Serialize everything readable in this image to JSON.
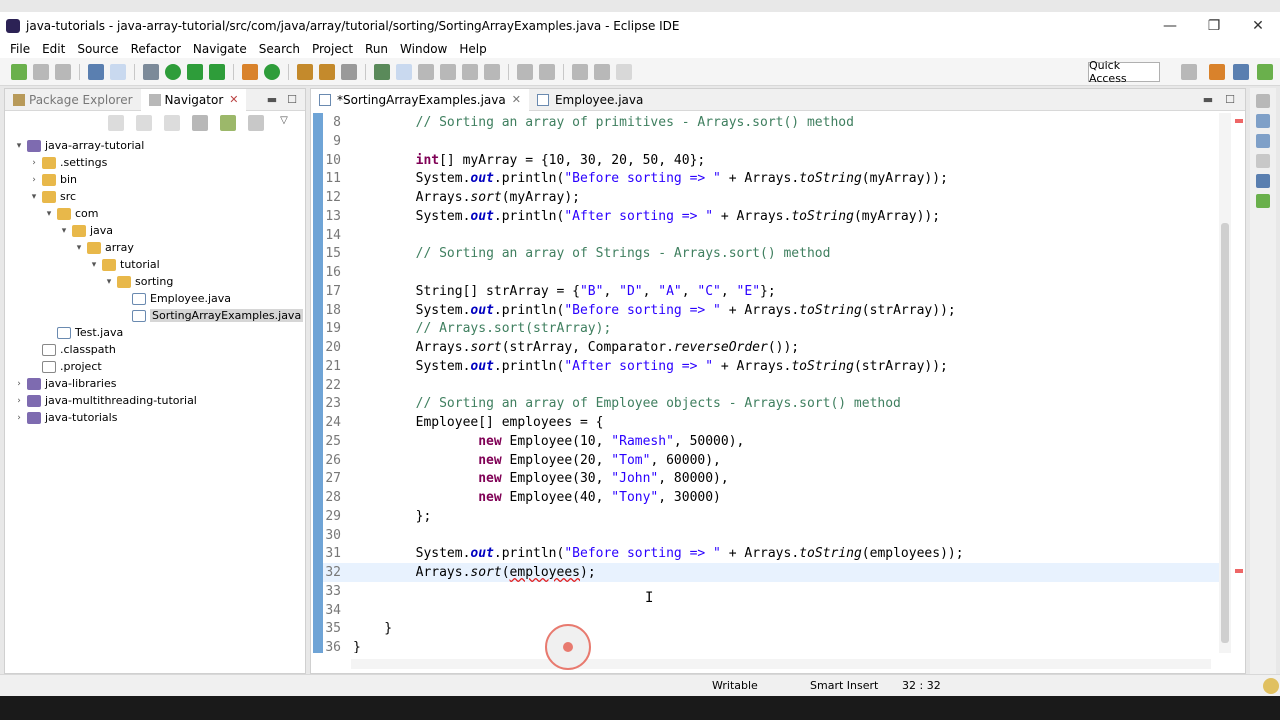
{
  "window": {
    "title": "java-tutorials - java-array-tutorial/src/com/java/array/tutorial/sorting/SortingArrayExamples.java - Eclipse IDE",
    "minimize": "—",
    "maximize": "❐",
    "close": "✕"
  },
  "menu": [
    "File",
    "Edit",
    "Source",
    "Refactor",
    "Navigate",
    "Search",
    "Project",
    "Run",
    "Window",
    "Help"
  ],
  "toolbar": {
    "quick_access": "Quick Access"
  },
  "left_panel": {
    "tabs": [
      {
        "label": "Package Explorer",
        "active": false
      },
      {
        "label": "Navigator",
        "active": true
      }
    ],
    "close_glyph": "✕",
    "tree": [
      {
        "label": "java-array-tutorial",
        "depth": 0,
        "arrow": "▾",
        "icon": "project"
      },
      {
        "label": ".settings",
        "depth": 1,
        "arrow": "›",
        "icon": "folder"
      },
      {
        "label": "bin",
        "depth": 1,
        "arrow": "›",
        "icon": "folder"
      },
      {
        "label": "src",
        "depth": 1,
        "arrow": "▾",
        "icon": "folder"
      },
      {
        "label": "com",
        "depth": 2,
        "arrow": "▾",
        "icon": "folder"
      },
      {
        "label": "java",
        "depth": 3,
        "arrow": "▾",
        "icon": "folder"
      },
      {
        "label": "array",
        "depth": 4,
        "arrow": "▾",
        "icon": "folder"
      },
      {
        "label": "tutorial",
        "depth": 5,
        "arrow": "▾",
        "icon": "folder"
      },
      {
        "label": "sorting",
        "depth": 6,
        "arrow": "▾",
        "icon": "folder"
      },
      {
        "label": "Employee.java",
        "depth": 7,
        "arrow": "",
        "icon": "javafile"
      },
      {
        "label": "SortingArrayExamples.java",
        "depth": 7,
        "arrow": "",
        "icon": "javafile",
        "selected": true
      },
      {
        "label": "Test.java",
        "depth": 2,
        "arrow": "",
        "icon": "javafile"
      },
      {
        "label": ".classpath",
        "depth": 1,
        "arrow": "",
        "icon": "xmlfile"
      },
      {
        "label": ".project",
        "depth": 1,
        "arrow": "",
        "icon": "xmlfile"
      },
      {
        "label": "java-libraries",
        "depth": 0,
        "arrow": "›",
        "icon": "project"
      },
      {
        "label": "java-multithreading-tutorial",
        "depth": 0,
        "arrow": "›",
        "icon": "project"
      },
      {
        "label": "java-tutorials",
        "depth": 0,
        "arrow": "›",
        "icon": "project"
      }
    ]
  },
  "editor": {
    "tabs": [
      {
        "label": "*SortingArrayExamples.java",
        "active": true
      },
      {
        "label": "Employee.java",
        "active": false
      }
    ],
    "close_glyph": "✕",
    "current_line": 32,
    "lines": [
      {
        "n": "8",
        "code": [
          [
            "        ",
            ""
          ],
          [
            "// Sorting an array of primitives - Arrays.sort() method",
            "cm"
          ]
        ]
      },
      {
        "n": "9",
        "code": []
      },
      {
        "n": "10",
        "code": [
          [
            "        ",
            ""
          ],
          [
            "int",
            "kw"
          ],
          [
            "[] myArray = {10, 30, 20, 50, 40};",
            ""
          ]
        ]
      },
      {
        "n": "11",
        "code": [
          [
            "        System.",
            ""
          ],
          [
            "out",
            "fld"
          ],
          [
            ".println(",
            ""
          ],
          [
            "\"Before sorting => \"",
            "st"
          ],
          [
            " + Arrays.",
            ""
          ],
          [
            "toString",
            "it"
          ],
          [
            "(myArray));",
            ""
          ]
        ]
      },
      {
        "n": "12",
        "code": [
          [
            "        Arrays.",
            ""
          ],
          [
            "sort",
            "it"
          ],
          [
            "(myArray);",
            ""
          ]
        ]
      },
      {
        "n": "13",
        "code": [
          [
            "        System.",
            ""
          ],
          [
            "out",
            "fld"
          ],
          [
            ".println(",
            ""
          ],
          [
            "\"After sorting => \"",
            "st"
          ],
          [
            " + Arrays.",
            ""
          ],
          [
            "toString",
            "it"
          ],
          [
            "(myArray));",
            ""
          ]
        ]
      },
      {
        "n": "14",
        "code": []
      },
      {
        "n": "15",
        "code": [
          [
            "        ",
            ""
          ],
          [
            "// Sorting an array of Strings - Arrays.sort() method",
            "cm"
          ]
        ]
      },
      {
        "n": "16",
        "code": []
      },
      {
        "n": "17",
        "code": [
          [
            "        String[] strArray = {",
            ""
          ],
          [
            "\"B\"",
            "st"
          ],
          [
            ", ",
            ""
          ],
          [
            "\"D\"",
            "st"
          ],
          [
            ", ",
            ""
          ],
          [
            "\"A\"",
            "st"
          ],
          [
            ", ",
            ""
          ],
          [
            "\"C\"",
            "st"
          ],
          [
            ", ",
            ""
          ],
          [
            "\"E\"",
            "st"
          ],
          [
            "};",
            ""
          ]
        ]
      },
      {
        "n": "18",
        "code": [
          [
            "        System.",
            ""
          ],
          [
            "out",
            "fld"
          ],
          [
            ".println(",
            ""
          ],
          [
            "\"Before sorting => \"",
            "st"
          ],
          [
            " + Arrays.",
            ""
          ],
          [
            "toString",
            "it"
          ],
          [
            "(strArray));",
            ""
          ]
        ]
      },
      {
        "n": "19",
        "code": [
          [
            "        ",
            ""
          ],
          [
            "// Arrays.sort(strArray);",
            "cm"
          ]
        ]
      },
      {
        "n": "20",
        "code": [
          [
            "        Arrays.",
            ""
          ],
          [
            "sort",
            "it"
          ],
          [
            "(strArray, Comparator.",
            ""
          ],
          [
            "reverseOrder",
            "it"
          ],
          [
            "());",
            ""
          ]
        ]
      },
      {
        "n": "21",
        "code": [
          [
            "        System.",
            ""
          ],
          [
            "out",
            "fld"
          ],
          [
            ".println(",
            ""
          ],
          [
            "\"After sorting => \"",
            "st"
          ],
          [
            " + Arrays.",
            ""
          ],
          [
            "toString",
            "it"
          ],
          [
            "(strArray));",
            ""
          ]
        ]
      },
      {
        "n": "22",
        "code": []
      },
      {
        "n": "23",
        "code": [
          [
            "        ",
            ""
          ],
          [
            "// Sorting an array of Employee objects - Arrays.sort() method",
            "cm"
          ]
        ]
      },
      {
        "n": "24",
        "code": [
          [
            "        Employee[] employees = {",
            ""
          ]
        ]
      },
      {
        "n": "25",
        "code": [
          [
            "                ",
            ""
          ],
          [
            "new",
            "kw"
          ],
          [
            " Employee(10, ",
            ""
          ],
          [
            "\"Ramesh\"",
            "st"
          ],
          [
            ", 50000),",
            ""
          ]
        ]
      },
      {
        "n": "26",
        "code": [
          [
            "                ",
            ""
          ],
          [
            "new",
            "kw"
          ],
          [
            " Employee(20, ",
            ""
          ],
          [
            "\"Tom\"",
            "st"
          ],
          [
            ", 60000),",
            ""
          ]
        ]
      },
      {
        "n": "27",
        "code": [
          [
            "                ",
            ""
          ],
          [
            "new",
            "kw"
          ],
          [
            " Employee(30, ",
            ""
          ],
          [
            "\"John\"",
            "st"
          ],
          [
            ", 80000),",
            ""
          ]
        ]
      },
      {
        "n": "28",
        "code": [
          [
            "                ",
            ""
          ],
          [
            "new",
            "kw"
          ],
          [
            " Employee(40, ",
            ""
          ],
          [
            "\"Tony\"",
            "st"
          ],
          [
            ", 30000)",
            ""
          ]
        ]
      },
      {
        "n": "29",
        "code": [
          [
            "        };",
            ""
          ]
        ]
      },
      {
        "n": "30",
        "code": []
      },
      {
        "n": "31",
        "code": [
          [
            "        System.",
            ""
          ],
          [
            "out",
            "fld"
          ],
          [
            ".println(",
            ""
          ],
          [
            "\"Before sorting => \"",
            "st"
          ],
          [
            " + Arrays.",
            ""
          ],
          [
            "toString",
            "it"
          ],
          [
            "(employees));",
            ""
          ]
        ]
      },
      {
        "n": "32",
        "code": [
          [
            "        Arrays.",
            ""
          ],
          [
            "sort",
            "it"
          ],
          [
            "(",
            ""
          ],
          [
            "employees",
            "err"
          ],
          [
            ");",
            ""
          ]
        ]
      },
      {
        "n": "33",
        "code": []
      },
      {
        "n": "34",
        "code": []
      },
      {
        "n": "35",
        "code": [
          [
            "    }",
            ""
          ]
        ]
      },
      {
        "n": "36",
        "code": [
          [
            "}",
            ""
          ]
        ]
      }
    ]
  },
  "status": {
    "writable": "Writable",
    "insert_mode": "Smart Insert",
    "position": "32 : 32"
  }
}
